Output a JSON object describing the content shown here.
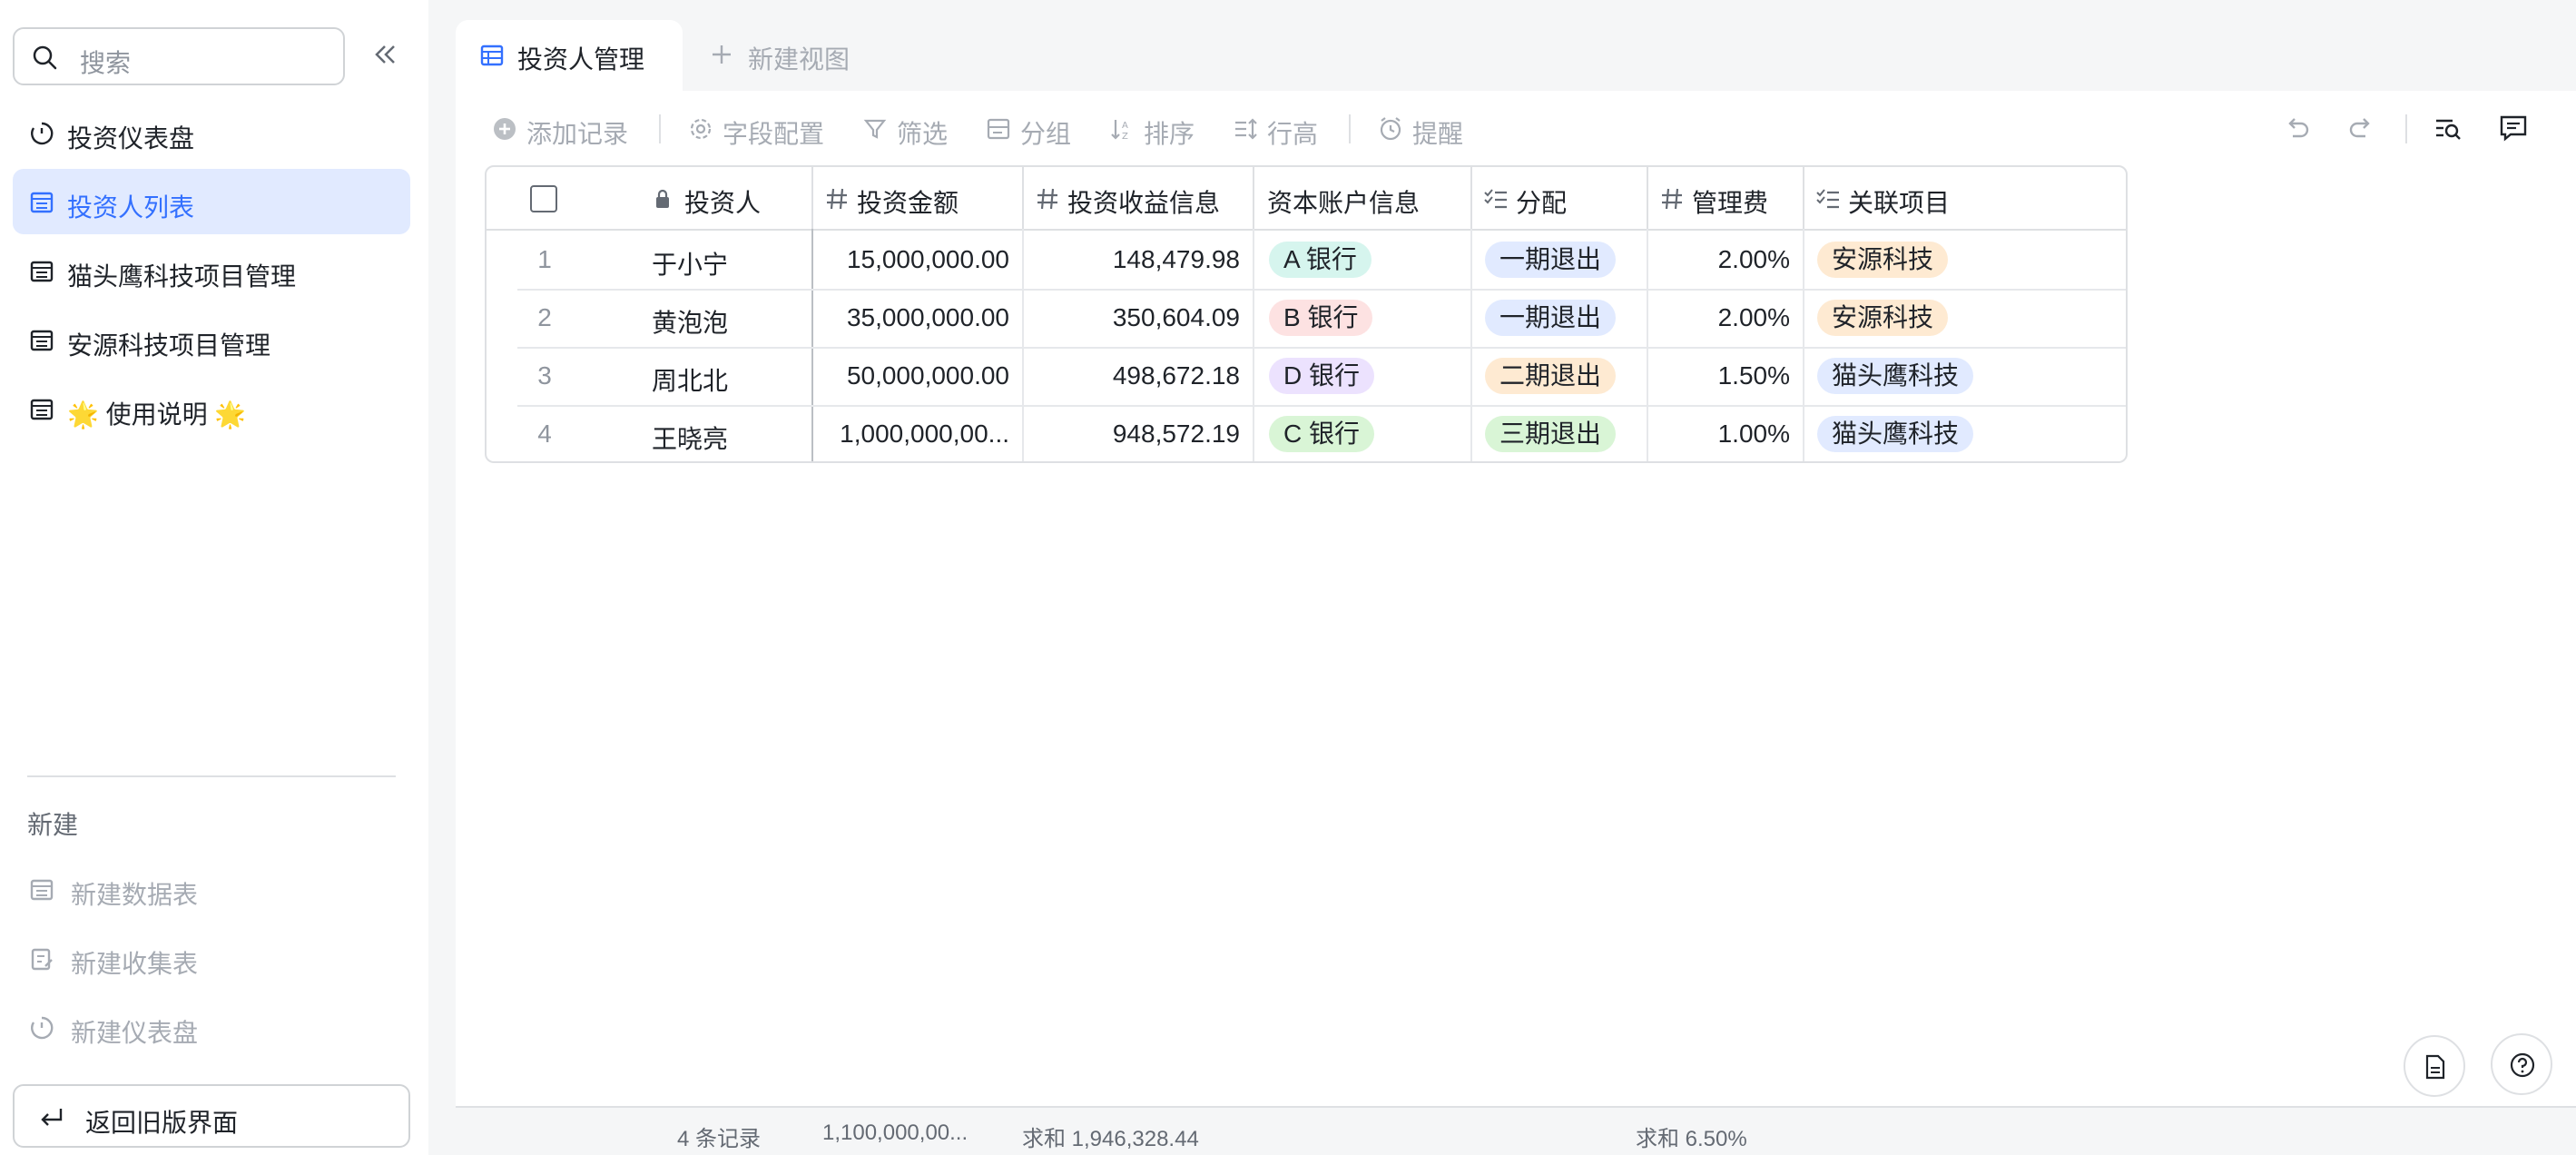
{
  "sidebar": {
    "search_placeholder": "搜索",
    "items": [
      {
        "label": "投资仪表盘",
        "icon": "dashboard-icon"
      },
      {
        "label": "投资人列表",
        "icon": "table-icon"
      },
      {
        "label": "猫头鹰科技项目管理",
        "icon": "table-icon"
      },
      {
        "label": "安源科技项目管理",
        "icon": "table-icon"
      },
      {
        "label": "🌟 使用说明 🌟",
        "icon": "table-icon"
      }
    ],
    "active_index": 1,
    "new_section_title": "新建",
    "new_items": [
      {
        "label": "新建数据表",
        "icon": "table-icon"
      },
      {
        "label": "新建收集表",
        "icon": "form-icon"
      },
      {
        "label": "新建仪表盘",
        "icon": "dashboard-icon"
      }
    ],
    "back_label": "返回旧版界面"
  },
  "view_tabs": {
    "active_label": "投资人管理",
    "new_view_label": "新建视图"
  },
  "toolbar": {
    "add_record": "添加记录",
    "field_config": "字段配置",
    "filter": "筛选",
    "group": "分组",
    "sort": "排序",
    "row_height": "行高",
    "reminder": "提醒"
  },
  "table": {
    "columns": [
      "投资人",
      "投资金额",
      "投资收益信息",
      "资本账户信息",
      "分配",
      "管理费",
      "关联项目"
    ],
    "rows": [
      {
        "n": "1",
        "investor": "于小宁",
        "amount": "15,000,000.00",
        "income": "148,479.98",
        "account": "A 银行",
        "distribution": "一期退出",
        "fee": "2.00%",
        "project": "安源科技"
      },
      {
        "n": "2",
        "investor": "黄泡泡",
        "amount": "35,000,000.00",
        "income": "350,604.09",
        "account": "B 银行",
        "distribution": "一期退出",
        "fee": "2.00%",
        "project": "安源科技"
      },
      {
        "n": "3",
        "investor": "周北北",
        "amount": "50,000,000.00",
        "income": "498,672.18",
        "account": "D 银行",
        "distribution": "二期退出",
        "fee": "1.50%",
        "project": "猫头鹰科技"
      },
      {
        "n": "4",
        "investor": "王晓亮",
        "amount": "1,000,000,00...",
        "income": "948,572.19",
        "account": "C 银行",
        "distribution": "三期退出",
        "fee": "1.00%",
        "project": "猫头鹰科技"
      }
    ]
  },
  "tag_colors": {
    "A 银行": "#d6f5ee",
    "B 银行": "#fde2e2",
    "C 银行": "#d9f5d6",
    "D 银行": "#ece2fe",
    "一期退出": "#e1eaff",
    "二期退出": "#feead2",
    "三期退出": "#d9f5d6",
    "安源科技": "#feead2",
    "猫头鹰科技": "#e1eaff"
  },
  "footer": {
    "record_count": "4 条记录",
    "amount_summary": "1,100,000,00...",
    "income_summary": "求和 1,946,328.44",
    "fee_summary": "求和 6.50%"
  },
  "colors": {
    "accent": "#3370ff",
    "active_bg": "#e1eaff"
  }
}
